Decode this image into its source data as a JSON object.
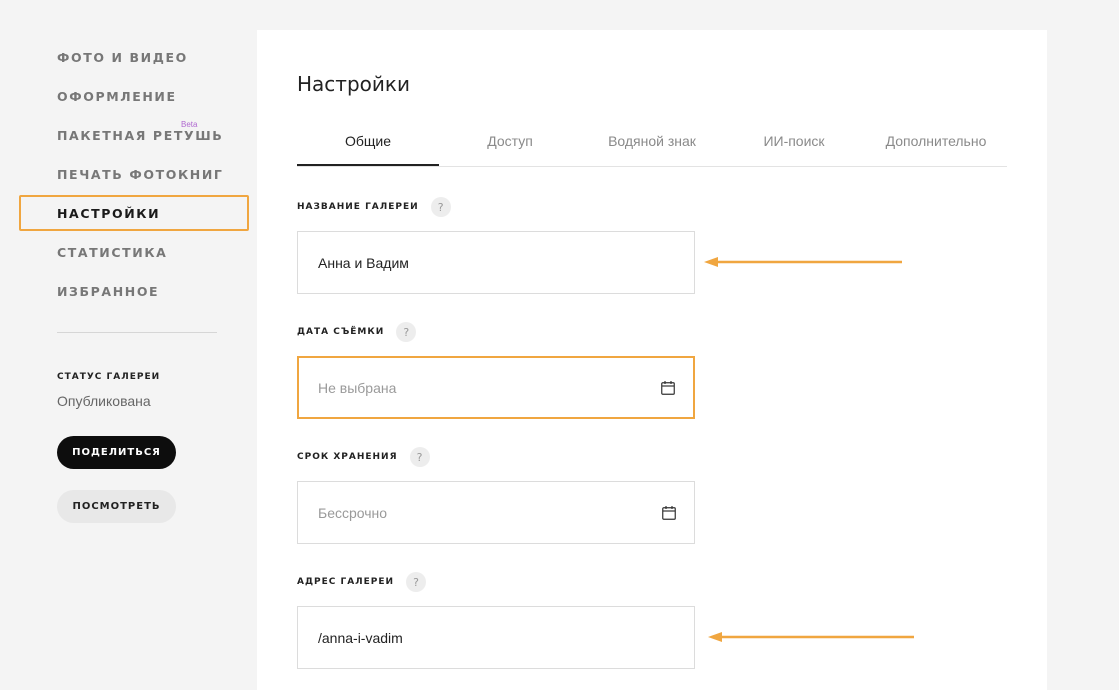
{
  "sidebar": {
    "items": [
      {
        "label": "ФОТО И ВИДЕО"
      },
      {
        "label": "ОФОРМЛЕНИЕ"
      },
      {
        "label": "ПАКЕТНАЯ РЕТУШЬ",
        "badge": "Beta"
      },
      {
        "label": "ПЕЧАТЬ ФОТОКНИГ"
      },
      {
        "label": "НАСТРОЙКИ"
      },
      {
        "label": "СТАТИСТИКА"
      },
      {
        "label": "ИЗБРАННОЕ"
      }
    ],
    "status_label": "СТАТУС ГАЛЕРЕИ",
    "status_value": "Опубликована",
    "share_label": "ПОДЕЛИТЬСЯ",
    "view_label": "ПОСМОТРЕТЬ"
  },
  "main": {
    "title": "Настройки",
    "tabs": [
      {
        "label": "Общие"
      },
      {
        "label": "Доступ"
      },
      {
        "label": "Водяной знак"
      },
      {
        "label": "ИИ-поиск"
      },
      {
        "label": "Дополнительно"
      }
    ],
    "fields": {
      "gallery_name": {
        "label": "НАЗВАНИЕ ГАЛЕРЕИ",
        "value": "Анна и Вадим"
      },
      "shoot_date": {
        "label": "ДАТА СЪЁМКИ",
        "placeholder": "Не выбрана"
      },
      "storage": {
        "label": "СРОК ХРАНЕНИЯ",
        "placeholder": "Бессрочно"
      },
      "address": {
        "label": "АДРЕС ГАЛЕРЕИ",
        "value": "/anna-i-vadim"
      }
    },
    "help_glyph": "?"
  },
  "colors": {
    "highlight": "#f0a640",
    "beta": "#b06ad0",
    "primary_button": "#0d0d0d"
  },
  "icons": {
    "calendar": "calendar-icon",
    "help": "question-icon",
    "annotation_arrow": "arrow-left-icon"
  }
}
